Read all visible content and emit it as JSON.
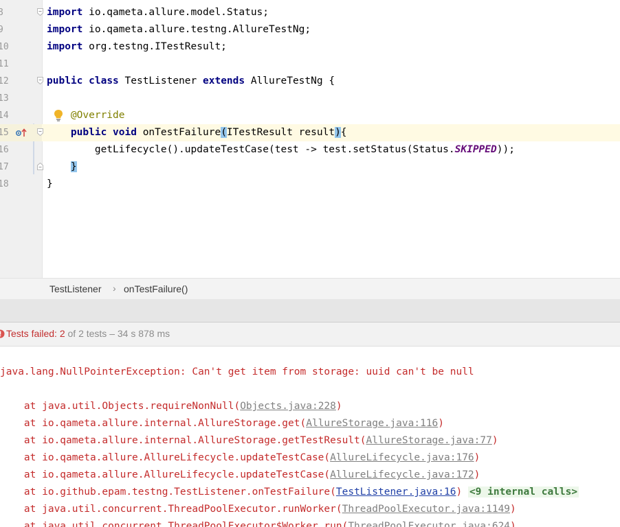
{
  "editor": {
    "lines": [
      {
        "num": "8",
        "parts": [
          {
            "t": "import",
            "c": "kw"
          },
          {
            "t": " io.qameta.allure.model.Status;"
          }
        ]
      },
      {
        "num": "9",
        "parts": [
          {
            "t": "import",
            "c": "kw"
          },
          {
            "t": " io.qameta.allure.testng.AllureTestNg;"
          }
        ]
      },
      {
        "num": "10",
        "parts": [
          {
            "t": "import",
            "c": "kw"
          },
          {
            "t": " org.testng.ITestResult;"
          }
        ]
      },
      {
        "num": "11",
        "parts": []
      },
      {
        "num": "12",
        "parts": [
          {
            "t": "public",
            "c": "kw"
          },
          {
            "t": " "
          },
          {
            "t": "class",
            "c": "kw"
          },
          {
            "t": " TestListener "
          },
          {
            "t": "extends",
            "c": "kw"
          },
          {
            "t": " AllureTestNg {"
          }
        ]
      },
      {
        "num": "13",
        "parts": []
      },
      {
        "num": "14",
        "parts": [
          {
            "t": "    "
          },
          {
            "t": "@Override",
            "c": "ann"
          }
        ]
      },
      {
        "num": "15",
        "parts": [
          {
            "t": "    "
          },
          {
            "t": "public",
            "c": "kw"
          },
          {
            "t": " "
          },
          {
            "t": "void",
            "c": "kw"
          },
          {
            "t": " onTestFailure"
          },
          {
            "t": "(",
            "c": "brace-hl"
          },
          {
            "t": "ITestResult result"
          },
          {
            "t": ")",
            "c": "brace-hl"
          },
          {
            "t": "{"
          }
        ]
      },
      {
        "num": "16",
        "parts": [
          {
            "t": "        getLifecycle().updateTestCase(test -> test.setStatus(Status."
          },
          {
            "t": "SKIPPED",
            "c": "static-field"
          },
          {
            "t": "));"
          }
        ]
      },
      {
        "num": "17",
        "parts": [
          {
            "t": "    "
          },
          {
            "t": "}",
            "c": "brace-hl"
          }
        ]
      },
      {
        "num": "18",
        "parts": [
          {
            "t": "}"
          }
        ]
      }
    ]
  },
  "breadcrumb": {
    "class_name": "TestListener",
    "separator": "›",
    "method_name": "onTestFailure()"
  },
  "test_status": {
    "failed_label": "Tests failed: 2",
    "rest_label": " of 2 tests – 34 s 878 ms"
  },
  "console": {
    "exception": "java.lang.NullPointerException: Can't get item from storage: uuid can't be null",
    "frames": [
      {
        "prefix": "    at java.util.Objects.requireNonNull(",
        "link": "Objects.java:228",
        "suffix": ")"
      },
      {
        "prefix": "    at io.qameta.allure.internal.AllureStorage.get(",
        "link": "AllureStorage.java:116",
        "suffix": ")"
      },
      {
        "prefix": "    at io.qameta.allure.internal.AllureStorage.getTestResult(",
        "link": "AllureStorage.java:77",
        "suffix": ")"
      },
      {
        "prefix": "    at io.qameta.allure.AllureLifecycle.updateTestCase(",
        "link": "AllureLifecycle.java:176",
        "suffix": ")"
      },
      {
        "prefix": "    at io.qameta.allure.AllureLifecycle.updateTestCase(",
        "link": "AllureLifecycle.java:172",
        "suffix": ")"
      },
      {
        "prefix": "    at io.github.epam.testng.TestListener.onTestFailure(",
        "link": "TestListener.java:16",
        "suffix": ") ",
        "active": true,
        "badge": "<9 internal calls>"
      },
      {
        "prefix": "    at java.util.concurrent.ThreadPoolExecutor.runWorker(",
        "link": "ThreadPoolExecutor.java:1149",
        "suffix": ")"
      },
      {
        "prefix": "    at java.util.concurrent.ThreadPoolExecutor$Worker.run(",
        "link": "ThreadPoolExecutor.java:624",
        "suffix": ")"
      }
    ]
  },
  "colors": {
    "keyword": "#000080",
    "annotation": "#808000",
    "static_field": "#660e7a",
    "current_line": "#fffae3",
    "error_text": "#c42b2b",
    "link_active": "#1f3fa6",
    "internal_calls_bg": "#edf7ea"
  },
  "icons": {
    "line_14": "lightbulb-icon",
    "line_15": "override-method-icon",
    "fold": "fold-marker-icon",
    "status": "test-failed-icon"
  }
}
